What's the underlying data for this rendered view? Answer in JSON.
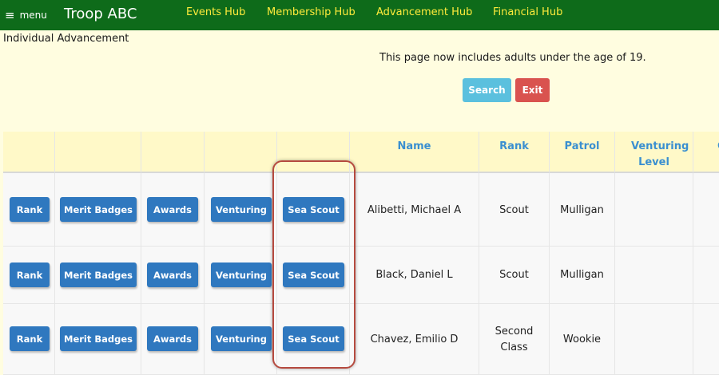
{
  "topbar": {
    "menu_glyph": "≡",
    "menu_label": "menu",
    "troop_name": "Troop ABC",
    "nav": [
      "Events Hub",
      "Membership Hub",
      "Advancement Hub",
      "Financial Hub"
    ]
  },
  "page": {
    "title": "Individual Advancement",
    "notice": "This page now includes adults under the age of 19.",
    "search_label": "Search",
    "exit_label": "Exit"
  },
  "table": {
    "headers": [
      "",
      "",
      "",
      "",
      "",
      "Name",
      "Rank",
      "Patrol",
      "Venturing Level",
      "C"
    ],
    "action_buttons": [
      "Rank",
      "Merit Badges",
      "Awards",
      "Venturing",
      "Sea Scout"
    ],
    "rows": [
      {
        "name": "Alibetti, Michael A",
        "rank": "Scout",
        "patrol": "Mulligan",
        "venturing_level": ""
      },
      {
        "name": "Black, Daniel L",
        "rank": "Scout",
        "patrol": "Mulligan",
        "venturing_level": ""
      },
      {
        "name": "Chavez, Emilio D",
        "rank": "Second Class",
        "patrol": "Wookie",
        "venturing_level": ""
      }
    ]
  },
  "colors": {
    "topbar": "#0e6b1a",
    "nav_link": "#ffeb3b",
    "page_background": "#fffde0",
    "search_button": "#5bc0de",
    "exit_button": "#d9534f",
    "action_button": "#2f78bf",
    "header_text": "#3a8fd0",
    "highlight": "#b54a3f"
  }
}
